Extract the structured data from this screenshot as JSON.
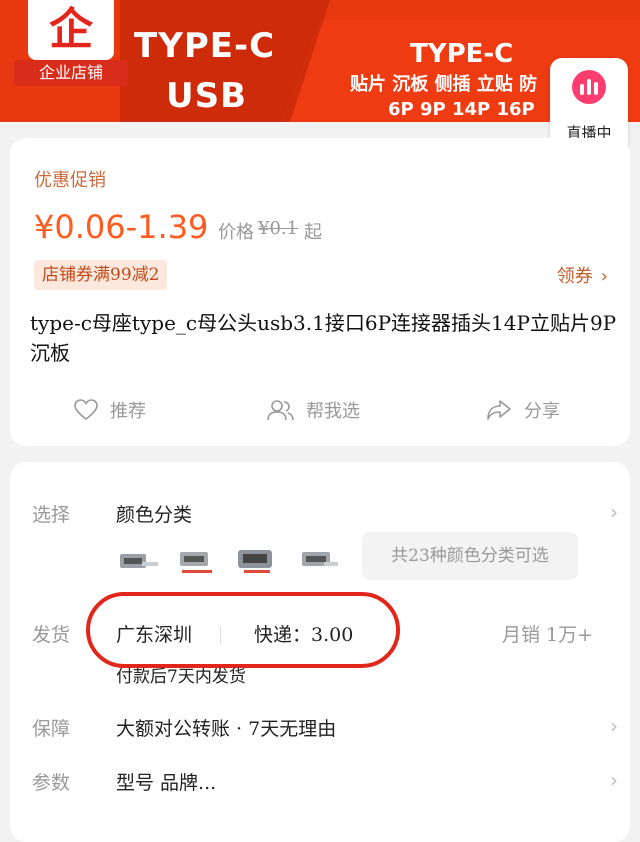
{
  "banner": {
    "store_badge": "企业店铺",
    "logo_glyph": "企",
    "type_line1": "TYPE-C",
    "type_line2": "USB",
    "right_title": "TYPE-C",
    "right_features": "贴片 沉板 侧插 立贴 防",
    "right_pins": "6P 9P 14P 16P",
    "accent": "#ef3b12"
  },
  "live": {
    "label": "直播中",
    "icon": "live-bars-icon"
  },
  "promo": {
    "title": "优惠促销",
    "price_range": "¥0.06-1.39",
    "price_label": "价格",
    "price_original": "¥0.1",
    "price_suffix": "起",
    "coupon": "店铺券满99减2",
    "get_coupon": "领券",
    "price_color": "#ff5a1f"
  },
  "product": {
    "title": "type-c母座type_c母公头usb3.1接口6P连接器插头14P立贴片9P沉板"
  },
  "actions": {
    "recommend": "推荐",
    "help_choose": "帮我选",
    "share": "分享"
  },
  "details": {
    "select_label": "选择",
    "select_value": "颜色分类",
    "variants_text": "共23种颜色分类可选",
    "ship_label": "发货",
    "ship_origin": "广东深圳",
    "ship_fee": "快递：3.00",
    "monthly_sales": "月销 1万+",
    "ship_note": "付款后7天内发货",
    "guarantee_label": "保障",
    "guarantee_value": "大额对公转账 · 7天无理由",
    "params_label": "参数",
    "params_value": "型号 品牌..."
  }
}
